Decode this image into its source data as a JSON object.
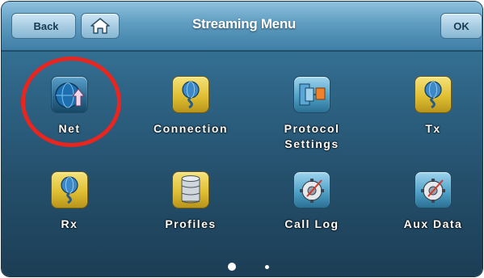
{
  "header": {
    "title": "Streaming Menu",
    "back_label": "Back",
    "ok_label": "OK"
  },
  "grid": {
    "items": [
      {
        "label": "Net",
        "icon": "net-globe-icon",
        "selected": true
      },
      {
        "label": "Connection",
        "icon": "connection-globe-cable-icon"
      },
      {
        "label": "Protocol\nSettings",
        "icon": "protocol-settings-icon"
      },
      {
        "label": "Tx",
        "icon": "tx-globe-cable-icon"
      },
      {
        "label": "Rx",
        "icon": "rx-globe-cable-icon"
      },
      {
        "label": "Profiles",
        "icon": "profiles-database-icon"
      },
      {
        "label": "Call Log",
        "icon": "call-log-gear-icon"
      },
      {
        "label": "Aux Data",
        "icon": "aux-data-gear-icon"
      }
    ]
  },
  "pagination": {
    "pages": 2,
    "current": 1
  },
  "colors": {
    "background": "#2f6688",
    "titlebar": "#5e9cc0",
    "highlight_ring": "#e8251f",
    "gold_tile": "#e0bf33",
    "teal_tile": "#4fa2c9"
  }
}
